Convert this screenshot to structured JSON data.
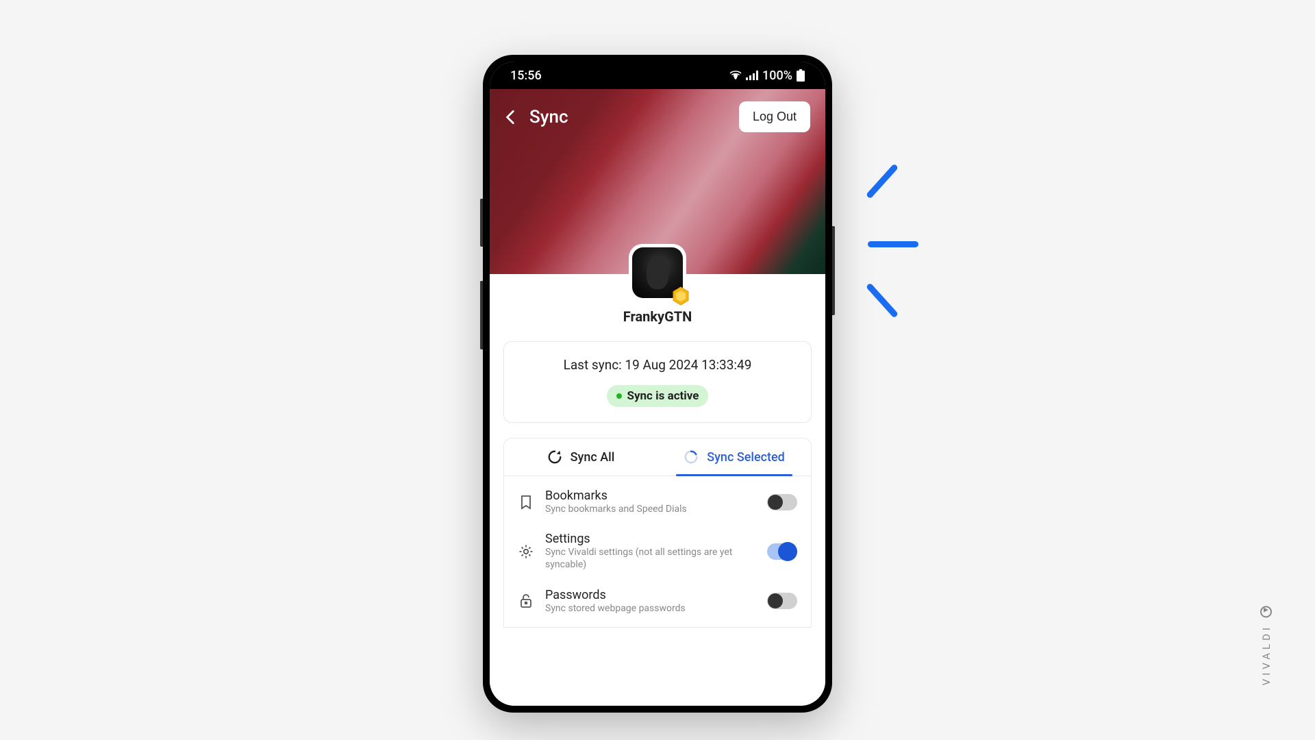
{
  "status_bar": {
    "time": "15:56",
    "battery": "100%"
  },
  "header": {
    "title": "Sync",
    "logout_label": "Log Out"
  },
  "profile": {
    "username": "FrankyGTN"
  },
  "sync_status": {
    "last_sync_label": "Last sync: 19 Aug 2024 13:33:49",
    "active_label": "Sync is active"
  },
  "tabs": {
    "all": "Sync All",
    "selected": "Sync Selected"
  },
  "items": [
    {
      "title": "Bookmarks",
      "subtitle": "Sync bookmarks and Speed Dials",
      "enabled": false
    },
    {
      "title": "Settings",
      "subtitle": "Sync Vivaldi settings (not all settings are yet syncable)",
      "enabled": true
    },
    {
      "title": "Passwords",
      "subtitle": "Sync stored webpage passwords",
      "enabled": false
    }
  ],
  "brand": "VIVALDI"
}
